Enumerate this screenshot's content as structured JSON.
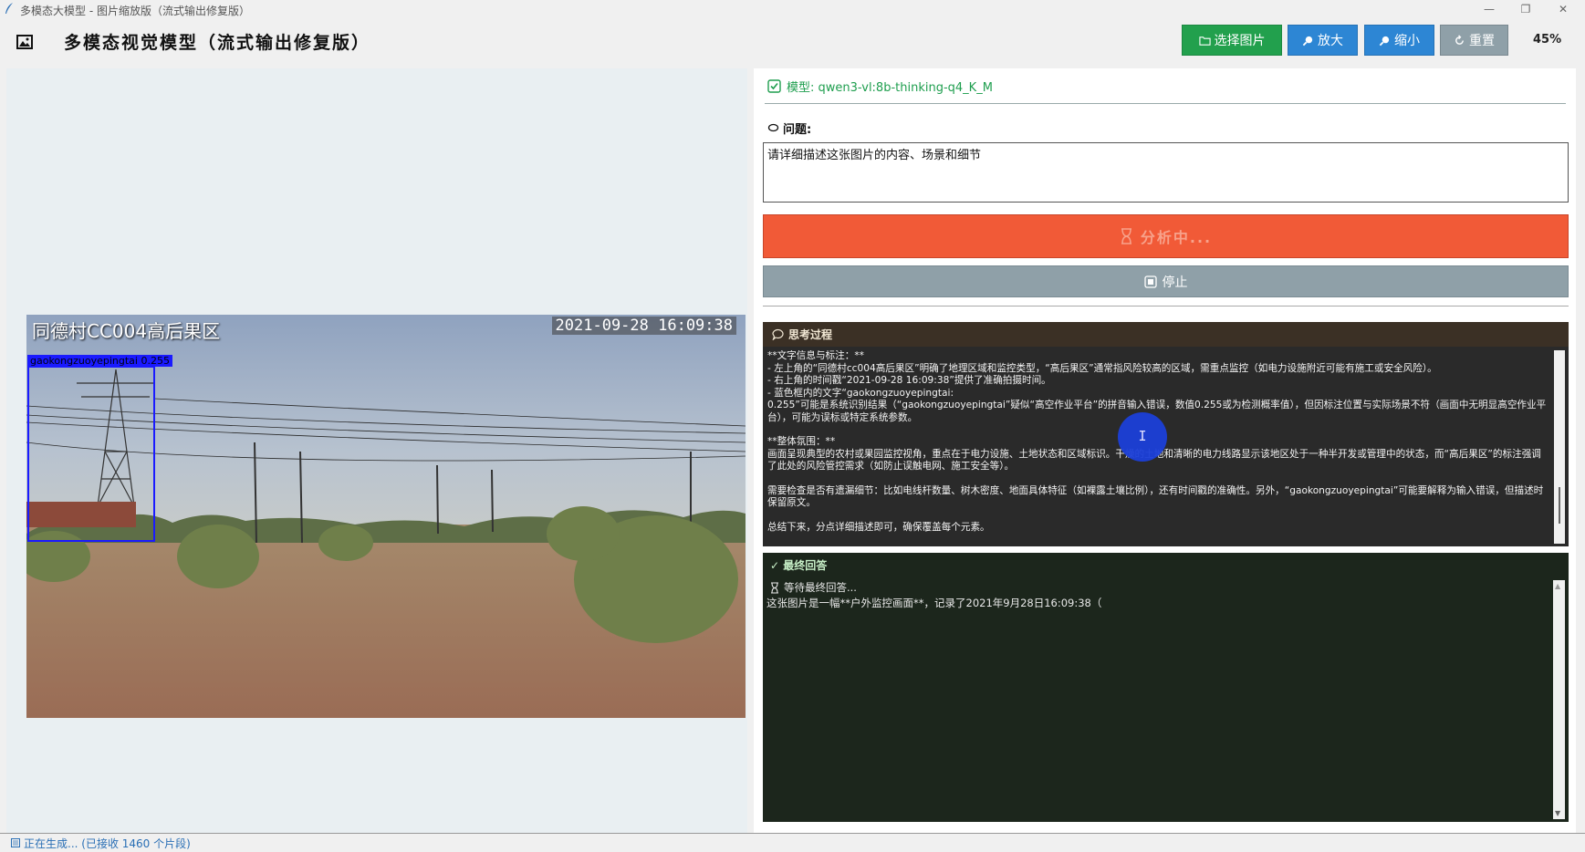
{
  "window": {
    "title": "多模态大模型 - 图片缩放版（流式输出修复版）",
    "minimize_glyph": "—",
    "maximize_glyph": "❐",
    "close_glyph": "✕"
  },
  "header": {
    "title": "多模态视觉模型（流式输出修复版）",
    "buttons": {
      "select_image": "选择图片",
      "zoom_in": "放大",
      "zoom_out": "缩小",
      "reset": "重置"
    },
    "zoom_level": "45%"
  },
  "image": {
    "osd_location": "同德村CC004高后果区",
    "osd_timestamp": "2021-09-28 16:09:38",
    "detection": {
      "label": "gaokongzuoyepingtai",
      "score": "0.255",
      "color": "#1a1aff"
    }
  },
  "model": {
    "label": "模型: qwen3-vl:8b-thinking-q4_K_M"
  },
  "question": {
    "label": "问题:",
    "value": "请详细描述这张图片的内容、场景和细节"
  },
  "actions": {
    "analyze_label": "分析中...",
    "stop_label": "停止"
  },
  "thinking": {
    "title": "思考过程",
    "lines": [
      "**文字信息与标注：**",
      "- 左上角的“同德村cc004高后果区”明确了地理区域和监控类型，“高后果区”通常指风险较高的区域，需重点监控（如电力设施附近可能有施工或安全风险）。",
      "- 右上角的时间戳“2021-09-28 16:09:38”提供了准确拍摄时间。",
      "- 蓝色框内的文字“gaokongzuoyepingtai:",
      "0.255”可能是系统识别结果（“gaokongzuoyepingtai”疑似“高空作业平台”的拼音输入错误，数值0.255或为检测概率值），但因标注位置与实际场景不符（画面中无明显高空作业平台），可能为误标或特定系统参数。",
      "",
      "**整体氛围：**",
      "画面呈现典型的农村或果园监控视角，重点在于电力设施、土地状态和区域标识。干燥的土地和清晰的电力线路显示该地区处于一种半开发或管理中的状态，而“高后果区”的标注强调了此处的风险管控需求（如防止误触电网、施工安全等）。",
      "",
      "需要检查是否有遗漏细节：比如电线杆数量、树木密度、地面具体特征（如裸露土壤比例），还有时间戳的准确性。另外，“gaokongzuoyepingtai”可能要解释为输入错误，但描述时保留原文。",
      "",
      "总结下来，分点详细描述即可，确保覆盖每个元素。"
    ]
  },
  "final_answer": {
    "title": "✓ 最终回答",
    "waiting": "等待最终回答...",
    "text": "这张图片是一幅**户外监控画面**，记录了2021年9月28日16:09:38（"
  },
  "status": {
    "text": "正在生成... (已接收 1460 个片段)"
  },
  "colors": {
    "select_button": "#22a04d",
    "zoom_buttons": "#2d86d4",
    "reset_button": "#8fa0a8",
    "analyze_button": "#f15a37",
    "thinking_header": "#3b3025",
    "final_panel": "#1c261c"
  },
  "icons": [
    "app-feather-icon",
    "image-logo-icon",
    "folder-icon",
    "magnifier-icon",
    "refresh-icon",
    "checkbox-icon",
    "speech-bubble-icon",
    "hourglass-icon",
    "stop-square-icon",
    "chat-bubble-icon",
    "status-icon"
  ]
}
